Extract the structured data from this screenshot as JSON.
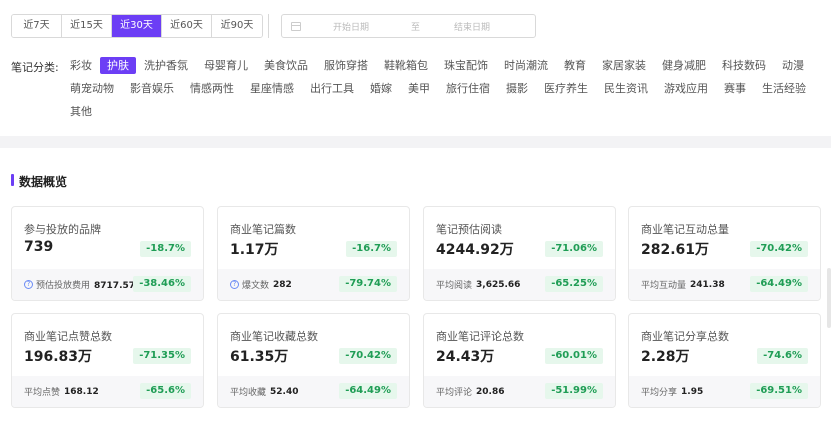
{
  "date_ranges": [
    {
      "label": "近7天",
      "active": false
    },
    {
      "label": "近15天",
      "active": false
    },
    {
      "label": "近30天",
      "active": true
    },
    {
      "label": "近60天",
      "active": false
    },
    {
      "label": "近90天",
      "active": false
    }
  ],
  "date_picker": {
    "start_placeholder": "开始日期",
    "separator": "至",
    "end_placeholder": "结束日期",
    "icon": "calendar-icon"
  },
  "categories": {
    "label": "笔记分类:",
    "items": [
      "彩妆",
      "护肤",
      "洗护香氛",
      "母婴育儿",
      "美食饮品",
      "服饰穿搭",
      "鞋靴箱包",
      "珠宝配饰",
      "时尚潮流",
      "教育",
      "家居家装",
      "健身减肥",
      "科技数码",
      "动漫",
      "萌宠动物",
      "影音娱乐",
      "情感两性",
      "星座情感",
      "出行工具",
      "婚嫁",
      "美甲",
      "旅行住宿",
      "摄影",
      "医疗养生",
      "民生资讯",
      "游戏应用",
      "赛事",
      "生活经验",
      "其他"
    ],
    "active_index": 1
  },
  "overview": {
    "title": "数据概览",
    "accent_color": "#6c3ef5",
    "cards": [
      {
        "label": "参与投放的品牌",
        "value": "739",
        "change": "-18.7%",
        "sub_label": "预估投放费用",
        "sub_value": "8717.57万",
        "sub_change": "-38.46%",
        "sub_icon": "question-icon"
      },
      {
        "label": "商业笔记篇数",
        "value": "1.17万",
        "change": "-16.7%",
        "sub_label": "爆文数",
        "sub_value": "282",
        "sub_change": "-79.74%",
        "sub_icon": "question-icon"
      },
      {
        "label": "笔记预估阅读",
        "value": "4244.92万",
        "change": "-71.06%",
        "sub_label": "平均阅读",
        "sub_value": "3,625.66",
        "sub_change": "-65.25%",
        "sub_icon": ""
      },
      {
        "label": "商业笔记互动总量",
        "value": "282.61万",
        "change": "-70.42%",
        "sub_label": "平均互动量",
        "sub_value": "241.38",
        "sub_change": "-64.49%",
        "sub_icon": ""
      },
      {
        "label": "商业笔记点赞总数",
        "value": "196.83万",
        "change": "-71.35%",
        "sub_label": "平均点赞",
        "sub_value": "168.12",
        "sub_change": "-65.6%",
        "sub_icon": ""
      },
      {
        "label": "商业笔记收藏总数",
        "value": "61.35万",
        "change": "-70.42%",
        "sub_label": "平均收藏",
        "sub_value": "52.40",
        "sub_change": "-64.49%",
        "sub_icon": ""
      },
      {
        "label": "商业笔记评论总数",
        "value": "24.43万",
        "change": "-60.01%",
        "sub_label": "平均评论",
        "sub_value": "20.86",
        "sub_change": "-51.99%",
        "sub_icon": ""
      },
      {
        "label": "商业笔记分享总数",
        "value": "2.28万",
        "change": "-74.6%",
        "sub_label": "平均分享",
        "sub_value": "1.95",
        "sub_change": "-69.51%",
        "sub_icon": ""
      }
    ]
  }
}
